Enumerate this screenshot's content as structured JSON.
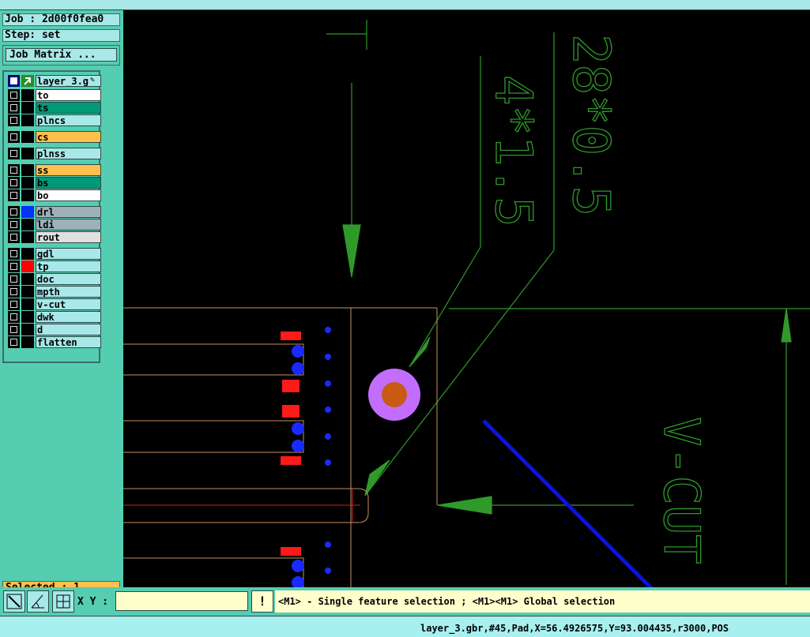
{
  "job": {
    "label": "Job : 2d00f0fea0",
    "step": "Step: set",
    "matrix_button": "Job Matrix ..."
  },
  "layer_header": {
    "name": "layer_3.g"
  },
  "layers": [
    {
      "name": "to",
      "bg": "#ffffff",
      "swatch": "#000000"
    },
    {
      "name": "ts",
      "bg": "#009a77",
      "swatch": "#000000"
    },
    {
      "name": "plncs",
      "bg": "#a8e8e8",
      "swatch": "#000000"
    },
    {
      "name": "cs",
      "bg": "#ffc04d",
      "swatch": "#000000"
    },
    {
      "name": "plnss",
      "bg": "#a8e8e8",
      "swatch": "#000000"
    },
    {
      "name": "ss",
      "bg": "#ffc04d",
      "swatch": "#000000"
    },
    {
      "name": "bs",
      "bg": "#009a77",
      "swatch": "#000000"
    },
    {
      "name": "bo",
      "bg": "#ffffff",
      "swatch": "#000000"
    },
    {
      "name": "drl",
      "bg": "#9fb0b8",
      "swatch": "#0033ff"
    },
    {
      "name": "ldi",
      "bg": "#9fb0b8",
      "swatch": "#000000"
    },
    {
      "name": "rout",
      "bg": "#e0e0e0",
      "swatch": "#000000"
    },
    {
      "name": "gdl",
      "bg": "#a8e8e8",
      "swatch": "#000000"
    },
    {
      "name": "tp",
      "bg": "#a8e8e8",
      "swatch": "#ff0000"
    },
    {
      "name": "doc",
      "bg": "#a8e8e8",
      "swatch": "#000000"
    },
    {
      "name": "mpth",
      "bg": "#a8e8e8",
      "swatch": "#000000"
    },
    {
      "name": "v-cut",
      "bg": "#a8e8e8",
      "swatch": "#000000"
    },
    {
      "name": "dwk",
      "bg": "#a8e8e8",
      "swatch": "#000000"
    },
    {
      "name": "d",
      "bg": "#a8e8e8",
      "swatch": "#000000"
    },
    {
      "name": "flatten",
      "bg": "#a8e8e8",
      "swatch": "#000000"
    }
  ],
  "selected": "Selected : 1",
  "toolbar": {
    "xy_label": "X Y :",
    "xy_value": "",
    "exclaim": "!"
  },
  "hint": "<M1> - Single feature selection ; <M1><M1> Global selection",
  "status": "layer_3.gbr,#45,Pad,X=56.4926575,Y=93.004435,r3000,POS",
  "canvas_text": {
    "dim1": "28*0.5",
    "dim2": "4*1.5",
    "vcut": "V-CUT",
    "tmark": "T"
  }
}
